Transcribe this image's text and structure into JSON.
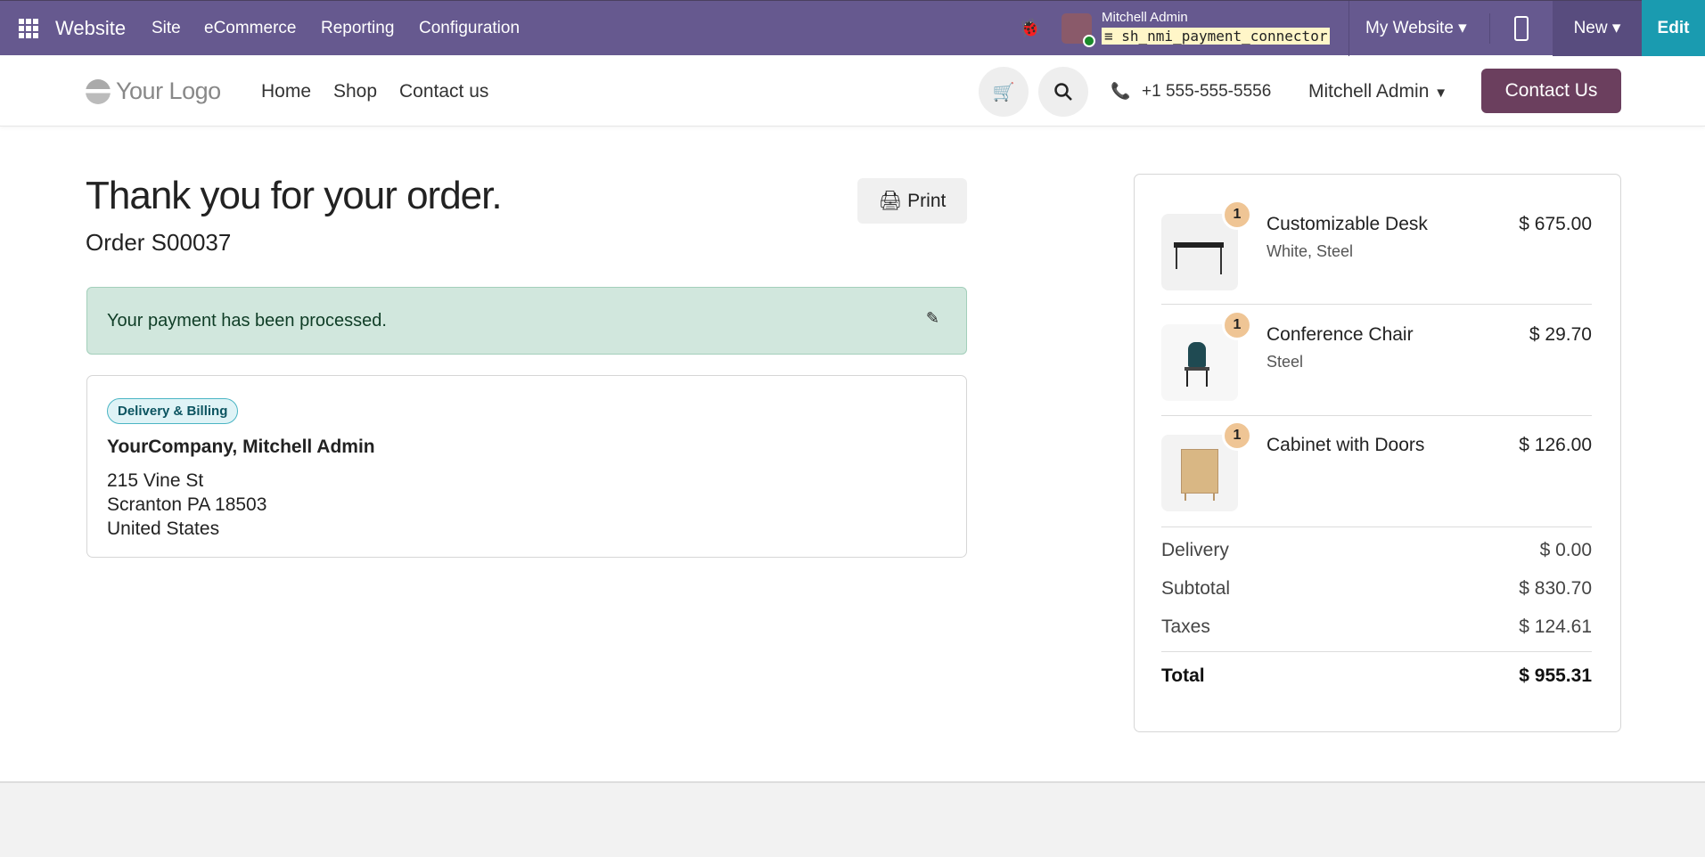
{
  "topbar": {
    "app": "Website",
    "menus": [
      "Site",
      "eCommerce",
      "Reporting",
      "Configuration"
    ],
    "user": "Mitchell Admin",
    "database": "sh_nmi_payment_connector",
    "website": "My Website",
    "new": "New",
    "edit": "Edit"
  },
  "header": {
    "logo": "Your Logo",
    "nav": [
      "Home",
      "Shop",
      "Contact us"
    ],
    "phone": "+1 555-555-5556",
    "user": "Mitchell Admin",
    "cta": "Contact Us"
  },
  "main": {
    "title": "Thank you for your order.",
    "order": "Order S00037",
    "print": "Print",
    "alert": "Your payment has been processed.",
    "badge": "Delivery & Billing",
    "name": "YourCompany, Mitchell Admin",
    "address": [
      "215 Vine St",
      "Scranton PA 18503",
      "United States"
    ]
  },
  "cart": {
    "items": [
      {
        "qty": "1",
        "name": "Customizable Desk",
        "variant": "White, Steel",
        "price": "$ 675.00"
      },
      {
        "qty": "1",
        "name": "Conference Chair",
        "variant": "Steel",
        "price": "$ 29.70"
      },
      {
        "qty": "1",
        "name": "Cabinet with Doors",
        "variant": "",
        "price": "$ 126.00"
      }
    ],
    "delivery_label": "Delivery",
    "delivery": "$ 0.00",
    "subtotal_label": "Subtotal",
    "subtotal": "$ 830.70",
    "taxes_label": "Taxes",
    "taxes": "$ 124.61",
    "total_label": "Total",
    "total": "$ 955.31"
  },
  "colors": {
    "topbar": "#66598f",
    "edit": "#1a9bb0",
    "cta": "#6b3f5e",
    "alert": "#d1e7dd"
  }
}
